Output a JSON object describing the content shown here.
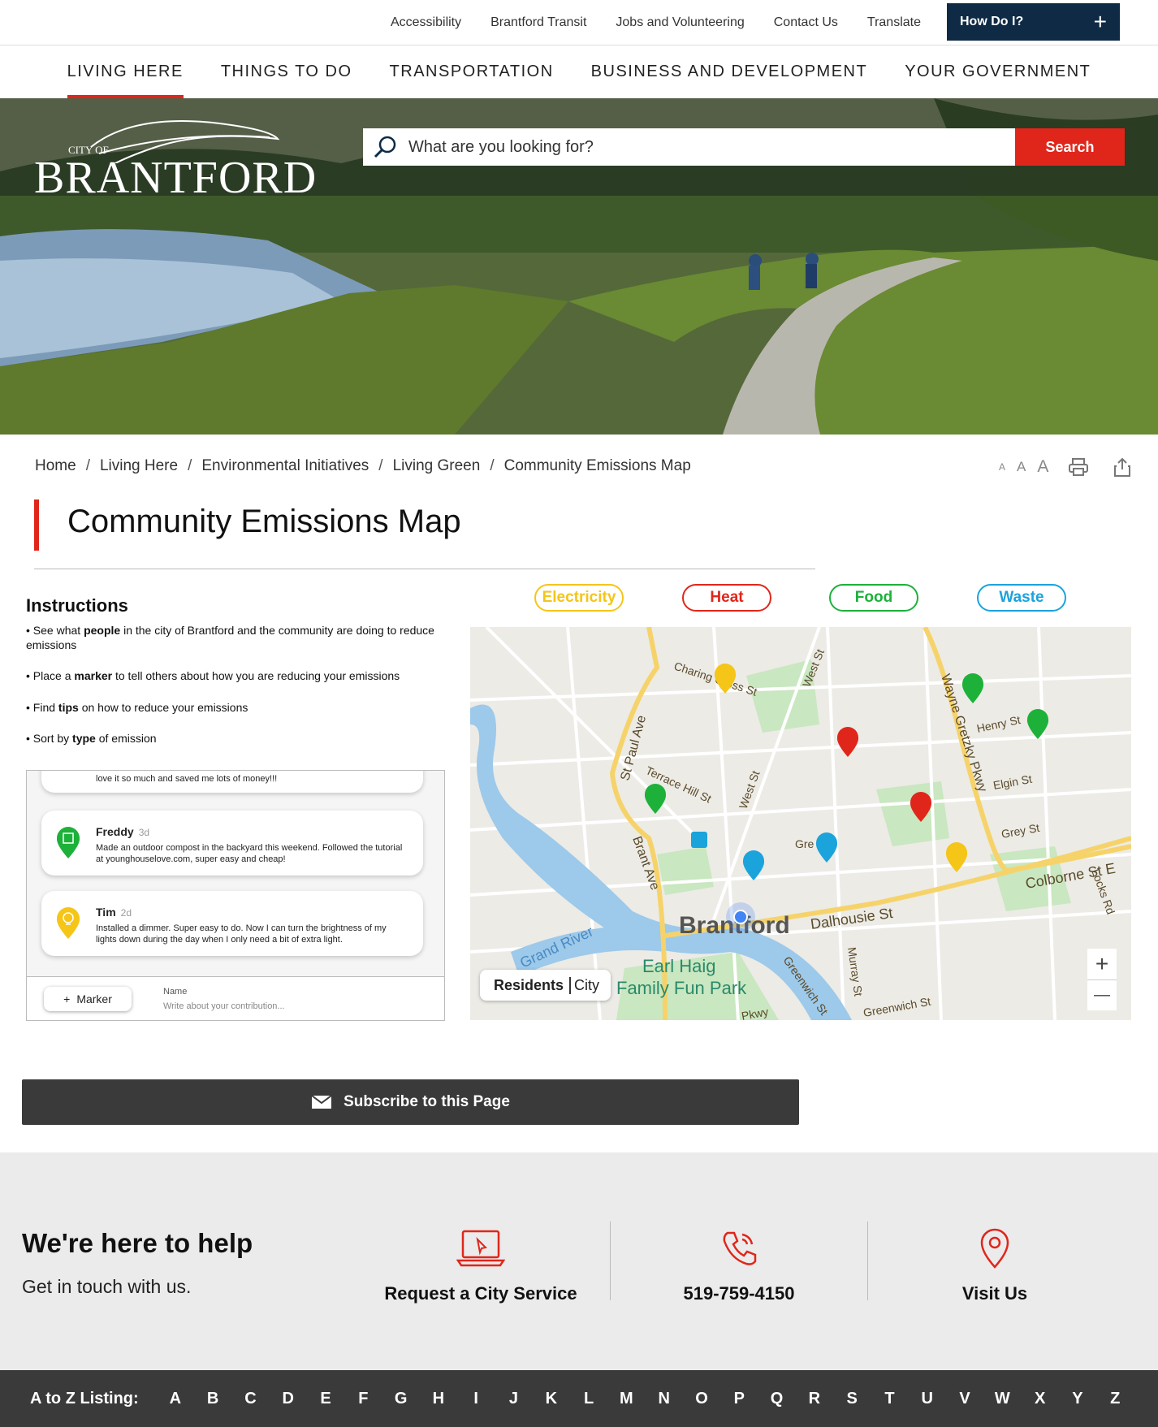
{
  "utility": {
    "links": [
      "Accessibility",
      "Brantford Transit",
      "Jobs and Volunteering",
      "Contact Us",
      "Translate"
    ],
    "how_do_i": "How Do I?"
  },
  "nav": [
    "LIVING HERE",
    "THINGS TO DO",
    "TRANSPORTATION",
    "BUSINESS AND DEVELOPMENT",
    "YOUR GOVERNMENT"
  ],
  "logo": {
    "city_of": "CITY OF",
    "name": "BRANTFORD"
  },
  "search": {
    "placeholder": "What are you looking for?",
    "button": "Search"
  },
  "breadcrumb": [
    "Home",
    "Living Here",
    "Environmental Initiatives",
    "Living Green",
    "Community Emissions Map"
  ],
  "text_size": [
    "A",
    "A",
    "A"
  ],
  "page_title": "Community Emissions Map",
  "instructions": {
    "heading": "Instructions",
    "items": [
      {
        "pre": "• See what ",
        "bold": "people",
        "post": " in the city of Brantford and the community are doing to reduce emissions"
      },
      {
        "pre": "• Place a ",
        "bold": "marker",
        "post": " to tell others about how you are reducing your emissions"
      },
      {
        "pre": "• Find ",
        "bold": "tips",
        "post": " on how to reduce your emissions"
      },
      {
        "pre": "• Sort by ",
        "bold": "type",
        "post": " of emission"
      }
    ]
  },
  "feed": {
    "partial_msg": "love it so much and saved me lots of money!!!",
    "posts": [
      {
        "name": "Freddy",
        "age": "3d",
        "msg": "Made an outdoor compost in the backyard this weekend. Followed the tutorial at younghouselove.com, super easy and cheap!",
        "type": "food"
      },
      {
        "name": "Tim",
        "age": "2d",
        "msg": "Installed a dimmer. Super easy to do. Now I can turn the brightness of my lights down during the day when I only need a bit of extra light.",
        "type": "electricity"
      }
    ],
    "marker_button": "Marker",
    "name_label": "Name",
    "write_placeholder": "Write about your contribution..."
  },
  "filters": [
    {
      "label": "Electricity",
      "color": "#f5c518"
    },
    {
      "label": "Heat",
      "color": "#e0261b"
    },
    {
      "label": "Food",
      "color": "#1db13a"
    },
    {
      "label": "Waste",
      "color": "#1ba3dc"
    }
  ],
  "map": {
    "streets": [
      "Charing Cross St",
      "West St",
      "Wayne Gretzky Pkwy",
      "Henry St",
      "St Paul Ave",
      "Terrace Hill St",
      "West St",
      "Elgin St",
      "Grey St",
      "Brant Ave",
      "Colborne St E",
      "Grand River",
      "Dalhousie St",
      "Locks Rd",
      "Earl Haig",
      "Family Fun Park",
      "Greenwich St",
      "Murray St",
      "Greenwich St",
      "Pkwy",
      "Gre"
    ],
    "city_label": "Brantford",
    "toggle": {
      "residents": "Residents",
      "city": "City"
    },
    "zoom_in": "+",
    "zoom_out": "—"
  },
  "subscribe": "Subscribe to this Page",
  "help": {
    "heading": "We're here to help",
    "sub": "Get in touch with us.",
    "items": [
      "Request a City Service",
      "519-759-4150",
      "Visit Us"
    ]
  },
  "atoz": {
    "label": "A to Z Listing:",
    "letters": [
      "A",
      "B",
      "C",
      "D",
      "E",
      "F",
      "G",
      "H",
      "I",
      "J",
      "K",
      "L",
      "M",
      "N",
      "O",
      "P",
      "Q",
      "R",
      "S",
      "T",
      "U",
      "V",
      "W",
      "X",
      "Y",
      "Z"
    ]
  }
}
